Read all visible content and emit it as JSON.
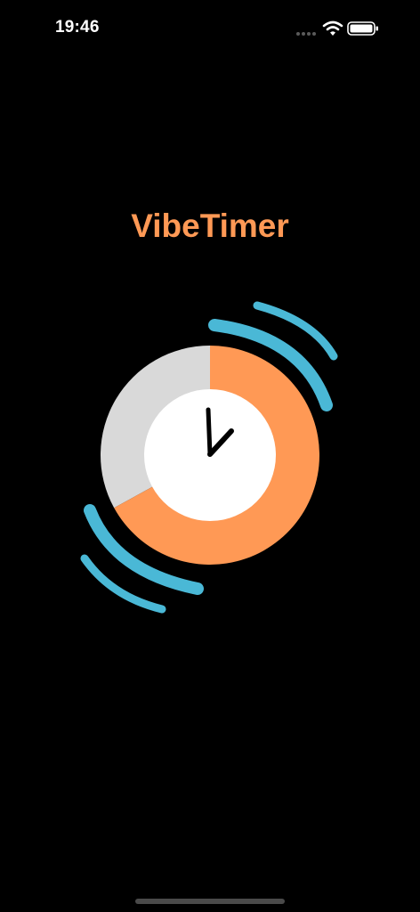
{
  "status_bar": {
    "time": "19:46"
  },
  "app": {
    "title": "VibeTimer"
  },
  "timer_graphic": {
    "elapsed_fraction": 0.67
  },
  "icons": {
    "signal": "cellular-signal-icon",
    "wifi": "wifi-icon",
    "battery": "battery-icon",
    "clock": "clock-icon",
    "vibration": "vibration-waves-icon"
  },
  "colors": {
    "background": "#000000",
    "accent_orange": "#ff9955",
    "vibration_blue": "#4ab8d6",
    "remaining_gray": "#d9d9d9",
    "clock_face": "#ffffff",
    "clock_hands": "#000000"
  }
}
